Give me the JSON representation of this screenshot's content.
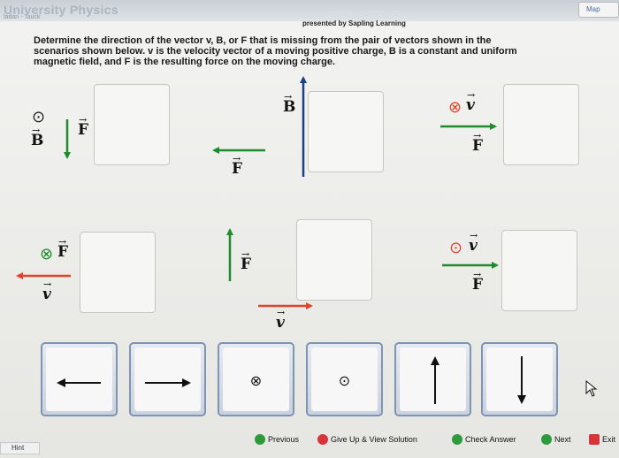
{
  "header": {
    "app_title": "University Physics",
    "app_subtitle": "ladan - Tauck",
    "map_label": "Map",
    "presented_by": "presented by Sapling Learning"
  },
  "question": {
    "line1": "Determine the direction of the vector v, B, or F that is missing from the pair of vectors shown in the",
    "line2": "scenarios shown below. v is the velocity vector of a moving positive charge, B is a constant and uniform",
    "line3": "magnetic field, and F is the resulting force on the moving charge."
  },
  "labels": {
    "B": "B",
    "F": "F",
    "v": "v"
  },
  "answer_tiles": [
    {
      "name": "left-arrow-tile",
      "glyph": "left-arrow-icon"
    },
    {
      "name": "right-arrow-tile",
      "glyph": "right-arrow-icon"
    },
    {
      "name": "into-page-tile",
      "glyph": "⊗"
    },
    {
      "name": "out-of-page-tile",
      "glyph": "⊙"
    },
    {
      "name": "up-arrow-tile",
      "glyph": "up-arrow-icon"
    },
    {
      "name": "down-arrow-tile",
      "glyph": "down-arrow-icon"
    }
  ],
  "buttons": {
    "previous": "Previous",
    "give_up": "Give Up & View Solution",
    "check": "Check Answer",
    "next": "Next",
    "exit": "Exit",
    "hint": "Hint"
  },
  "colors": {
    "force_green": "#1f8a2e",
    "velocity_red": "#e2432a",
    "field_blue": "#1c3f8a"
  }
}
